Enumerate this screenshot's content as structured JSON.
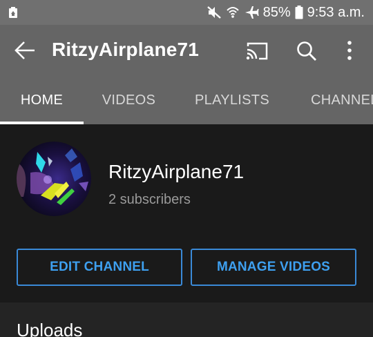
{
  "status_bar": {
    "battery_percent": "85%",
    "time": "9:53 a.m.",
    "icons": [
      "recycle-notification-icon",
      "mute-icon",
      "wifi-icon",
      "airplane-mode-icon",
      "battery-icon"
    ]
  },
  "app_bar": {
    "title": "RitzyAirplane71",
    "icons": [
      "back-arrow-icon",
      "cast-icon",
      "search-icon",
      "more-vert-icon"
    ]
  },
  "tabs": [
    {
      "label": "HOME",
      "active": true
    },
    {
      "label": "VIDEOS",
      "active": false
    },
    {
      "label": "PLAYLISTS",
      "active": false
    },
    {
      "label": "CHANNELS",
      "active": false
    }
  ],
  "channel": {
    "name": "RitzyAirplane71",
    "subscribers": "2 subscribers",
    "edit_label": "EDIT CHANNEL",
    "manage_label": "MANAGE VIDEOS"
  },
  "uploads": {
    "title": "Uploads"
  },
  "colors": {
    "status_bar": "#707070",
    "app_bar": "#656565",
    "background": "#1a1a1a",
    "accent_blue": "#3ea0f0"
  }
}
